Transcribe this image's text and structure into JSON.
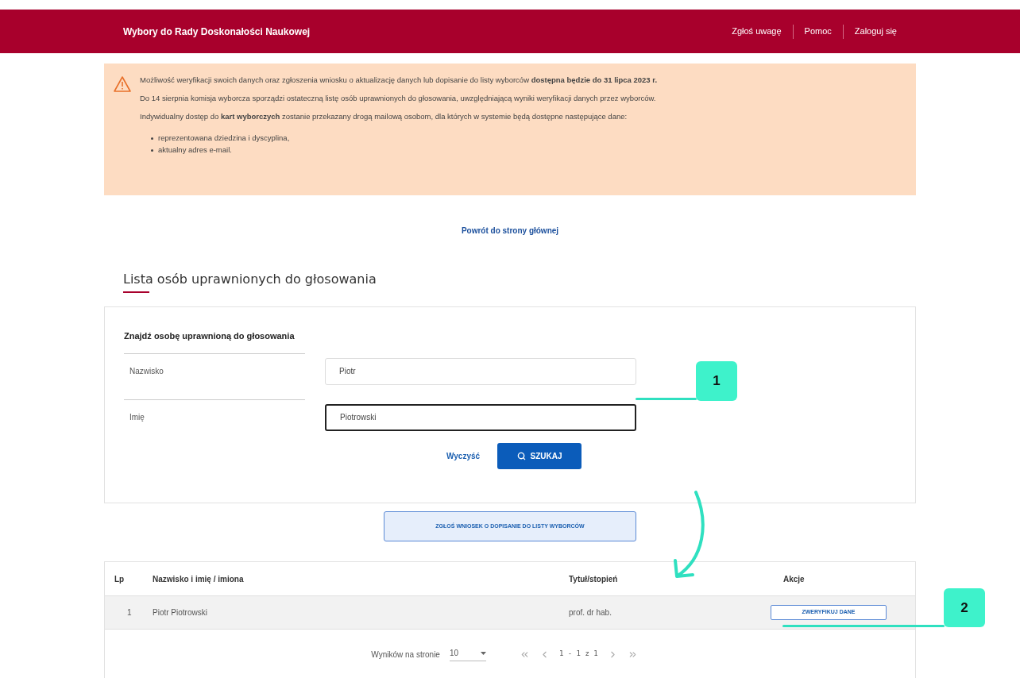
{
  "header": {
    "title": "Wybory do Rady Doskonałości Naukowej",
    "links": [
      "Zgłoś uwagę",
      "Pomoc",
      "Zaloguj się"
    ]
  },
  "alert": {
    "paragraphs": [
      "Możliwość weryfikacji swoich danych oraz zgłoszenia wniosku o aktualizację danych lub dopisanie do listy wyborców **dostępna będzie do 31 lipca 2023 r.**",
      "Do 14 sierpnia komisja wyborcza sporządzi ostateczną listę osób uprawnionych do głosowania, uwzględniającą wyniki weryfikacji danych przez wyborców.",
      "Indywidualny dostęp do **kart wyborczych** zostanie przekazany drogą mailową osobom, dla których w systemie będą dostępne następujące dane:"
    ],
    "bullets": [
      "reprezentowana dziedzina i dyscyplina,",
      "aktualny adres e-mail."
    ]
  },
  "back_link": "Powrót do strony głównej",
  "heading": "Lista osób uprawnionych do głosowania",
  "search": {
    "title": "Znajdź osobę uprawnioną do głosowania",
    "fields": [
      {
        "label": "Nazwisko",
        "value": "Piotr",
        "focused": false
      },
      {
        "label": "Imię",
        "value": "Piotrowski",
        "focused": true
      }
    ],
    "clear": "Wyczyść",
    "submit": "SZUKAJ"
  },
  "request_button": "ZGŁOŚ WNIOSEK O DOPISANIE DO LISTY WYBORCÓW",
  "table": {
    "columns": [
      "Lp",
      "Nazwisko i imię / imiona",
      "Tytuł/stopień",
      "Akcje"
    ],
    "rows": [
      {
        "lp": "1",
        "name": "Piotr Piotrowski",
        "title": "prof. dr hab.",
        "action": "ZWERYFIKUJ DANE"
      }
    ],
    "pagination": {
      "label": "Wyników na stronie",
      "page_size": "10",
      "range": "1 - 1 z 1"
    }
  },
  "annotations": [
    {
      "number": "1"
    },
    {
      "number": "2"
    }
  ]
}
